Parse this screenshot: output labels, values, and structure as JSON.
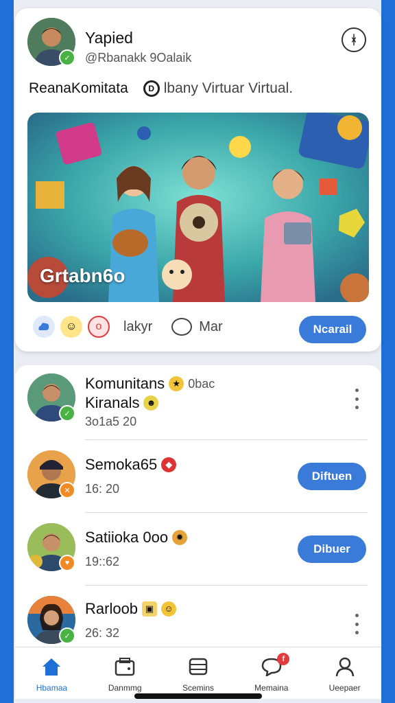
{
  "post": {
    "author_name": "Yapied",
    "author_handle": "@Rbanakk 9Oalaik",
    "close_icon": "ᚼ",
    "text_left": "ReanaKomitata",
    "text_ring": "D",
    "text_right": "lbany Virtuar Virtual.",
    "banner_label": "Grtabn6o",
    "like_label": "lakyr",
    "comment_label": "Mar",
    "action_label": "Ncarail"
  },
  "list": {
    "items": [
      {
        "title": "Komunitans",
        "title_suffix": "0bac",
        "subtitle": "Kiranals",
        "time": "3o1a5 20",
        "action": "more"
      },
      {
        "title": "Semoka65",
        "time": "16: 20",
        "action": "button",
        "button_label": "Diftuen"
      },
      {
        "title": "Satiioka 0oo",
        "time": "19::62",
        "action": "button",
        "button_label": "Dibuer"
      },
      {
        "title": "Rarloob",
        "time": "26: 32",
        "action": "more"
      }
    ]
  },
  "nav": {
    "items": [
      {
        "label": "Hbamaa",
        "icon": "home-icon",
        "active": true
      },
      {
        "label": "Danmmg",
        "icon": "wallet-icon",
        "active": false
      },
      {
        "label": "Scemins",
        "icon": "card-icon",
        "active": false
      },
      {
        "label": "Memaina",
        "icon": "chat-icon",
        "active": false,
        "badge": "f"
      },
      {
        "label": "Ueepaer",
        "icon": "profile-icon",
        "active": false
      }
    ]
  },
  "colors": {
    "accent": "#3a7ad8",
    "background": "#1f6fd6",
    "badge_green": "#49b244",
    "badge_orange": "#f08a24",
    "badge_red": "#e23b3b"
  }
}
